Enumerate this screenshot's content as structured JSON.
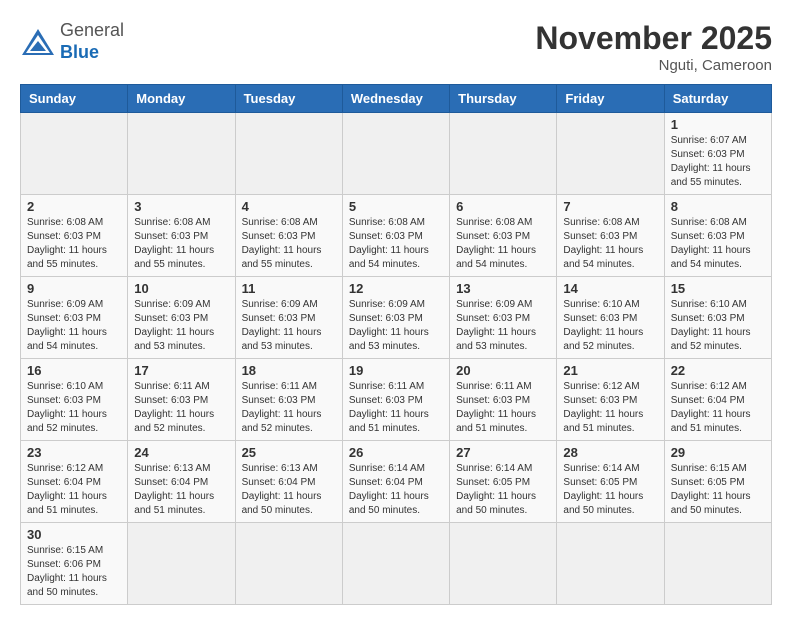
{
  "header": {
    "logo_general": "General",
    "logo_blue": "Blue",
    "month_title": "November 2025",
    "location": "Nguti, Cameroon"
  },
  "weekdays": [
    "Sunday",
    "Monday",
    "Tuesday",
    "Wednesday",
    "Thursday",
    "Friday",
    "Saturday"
  ],
  "weeks": [
    [
      {
        "day": "",
        "info": ""
      },
      {
        "day": "",
        "info": ""
      },
      {
        "day": "",
        "info": ""
      },
      {
        "day": "",
        "info": ""
      },
      {
        "day": "",
        "info": ""
      },
      {
        "day": "",
        "info": ""
      },
      {
        "day": "1",
        "info": "Sunrise: 6:07 AM\nSunset: 6:03 PM\nDaylight: 11 hours\nand 55 minutes."
      }
    ],
    [
      {
        "day": "2",
        "info": "Sunrise: 6:08 AM\nSunset: 6:03 PM\nDaylight: 11 hours\nand 55 minutes."
      },
      {
        "day": "3",
        "info": "Sunrise: 6:08 AM\nSunset: 6:03 PM\nDaylight: 11 hours\nand 55 minutes."
      },
      {
        "day": "4",
        "info": "Sunrise: 6:08 AM\nSunset: 6:03 PM\nDaylight: 11 hours\nand 55 minutes."
      },
      {
        "day": "5",
        "info": "Sunrise: 6:08 AM\nSunset: 6:03 PM\nDaylight: 11 hours\nand 54 minutes."
      },
      {
        "day": "6",
        "info": "Sunrise: 6:08 AM\nSunset: 6:03 PM\nDaylight: 11 hours\nand 54 minutes."
      },
      {
        "day": "7",
        "info": "Sunrise: 6:08 AM\nSunset: 6:03 PM\nDaylight: 11 hours\nand 54 minutes."
      },
      {
        "day": "8",
        "info": "Sunrise: 6:08 AM\nSunset: 6:03 PM\nDaylight: 11 hours\nand 54 minutes."
      }
    ],
    [
      {
        "day": "9",
        "info": "Sunrise: 6:09 AM\nSunset: 6:03 PM\nDaylight: 11 hours\nand 54 minutes."
      },
      {
        "day": "10",
        "info": "Sunrise: 6:09 AM\nSunset: 6:03 PM\nDaylight: 11 hours\nand 53 minutes."
      },
      {
        "day": "11",
        "info": "Sunrise: 6:09 AM\nSunset: 6:03 PM\nDaylight: 11 hours\nand 53 minutes."
      },
      {
        "day": "12",
        "info": "Sunrise: 6:09 AM\nSunset: 6:03 PM\nDaylight: 11 hours\nand 53 minutes."
      },
      {
        "day": "13",
        "info": "Sunrise: 6:09 AM\nSunset: 6:03 PM\nDaylight: 11 hours\nand 53 minutes."
      },
      {
        "day": "14",
        "info": "Sunrise: 6:10 AM\nSunset: 6:03 PM\nDaylight: 11 hours\nand 52 minutes."
      },
      {
        "day": "15",
        "info": "Sunrise: 6:10 AM\nSunset: 6:03 PM\nDaylight: 11 hours\nand 52 minutes."
      }
    ],
    [
      {
        "day": "16",
        "info": "Sunrise: 6:10 AM\nSunset: 6:03 PM\nDaylight: 11 hours\nand 52 minutes."
      },
      {
        "day": "17",
        "info": "Sunrise: 6:11 AM\nSunset: 6:03 PM\nDaylight: 11 hours\nand 52 minutes."
      },
      {
        "day": "18",
        "info": "Sunrise: 6:11 AM\nSunset: 6:03 PM\nDaylight: 11 hours\nand 52 minutes."
      },
      {
        "day": "19",
        "info": "Sunrise: 6:11 AM\nSunset: 6:03 PM\nDaylight: 11 hours\nand 51 minutes."
      },
      {
        "day": "20",
        "info": "Sunrise: 6:11 AM\nSunset: 6:03 PM\nDaylight: 11 hours\nand 51 minutes."
      },
      {
        "day": "21",
        "info": "Sunrise: 6:12 AM\nSunset: 6:03 PM\nDaylight: 11 hours\nand 51 minutes."
      },
      {
        "day": "22",
        "info": "Sunrise: 6:12 AM\nSunset: 6:04 PM\nDaylight: 11 hours\nand 51 minutes."
      }
    ],
    [
      {
        "day": "23",
        "info": "Sunrise: 6:12 AM\nSunset: 6:04 PM\nDaylight: 11 hours\nand 51 minutes."
      },
      {
        "day": "24",
        "info": "Sunrise: 6:13 AM\nSunset: 6:04 PM\nDaylight: 11 hours\nand 51 minutes."
      },
      {
        "day": "25",
        "info": "Sunrise: 6:13 AM\nSunset: 6:04 PM\nDaylight: 11 hours\nand 50 minutes."
      },
      {
        "day": "26",
        "info": "Sunrise: 6:14 AM\nSunset: 6:04 PM\nDaylight: 11 hours\nand 50 minutes."
      },
      {
        "day": "27",
        "info": "Sunrise: 6:14 AM\nSunset: 6:05 PM\nDaylight: 11 hours\nand 50 minutes."
      },
      {
        "day": "28",
        "info": "Sunrise: 6:14 AM\nSunset: 6:05 PM\nDaylight: 11 hours\nand 50 minutes."
      },
      {
        "day": "29",
        "info": "Sunrise: 6:15 AM\nSunset: 6:05 PM\nDaylight: 11 hours\nand 50 minutes."
      }
    ],
    [
      {
        "day": "30",
        "info": "Sunrise: 6:15 AM\nSunset: 6:06 PM\nDaylight: 11 hours\nand 50 minutes."
      },
      {
        "day": "",
        "info": ""
      },
      {
        "day": "",
        "info": ""
      },
      {
        "day": "",
        "info": ""
      },
      {
        "day": "",
        "info": ""
      },
      {
        "day": "",
        "info": ""
      },
      {
        "day": "",
        "info": ""
      }
    ]
  ]
}
